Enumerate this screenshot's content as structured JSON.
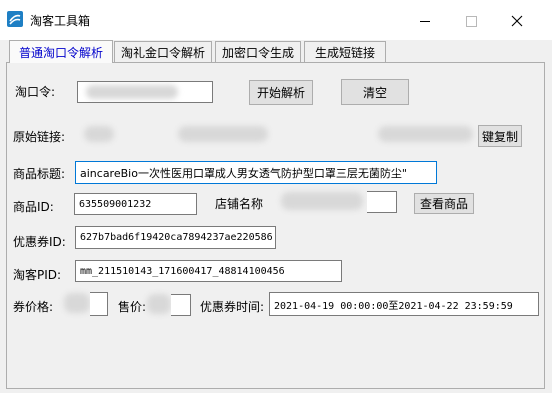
{
  "window": {
    "title": "淘客工具箱"
  },
  "tabs": [
    "普通淘口令解析",
    "淘礼金口令解析",
    "加密口令生成",
    "生成短链接"
  ],
  "form": {
    "taokouling_label": "淘口令:",
    "parse_button": "开始解析",
    "clear_button": "清空",
    "original_link_label": "原始链接:",
    "copy_button": "键复制",
    "product_title_label": "商品标题:",
    "product_title_value": "aincareBio一次性医用口罩成人男女透气防护型口罩三层无菌防尘\"",
    "product_id_label": "商品ID:",
    "product_id_value": "635509001232",
    "shop_name_label": "店铺名称",
    "view_product_button": "查看商品",
    "coupon_id_label": "优惠券ID:",
    "coupon_id_value": "627b7bad6f19420ca7894237ae220586",
    "pid_label": "淘客PID:",
    "pid_value": "mm_211510143_171600417_48814100456",
    "coupon_price_label": "券价格:",
    "price_label": "售价:",
    "coupon_time_label": "优惠券时间:",
    "coupon_time_value": "2021-04-19 00:00:00至2021-04-22 23:59:59"
  }
}
